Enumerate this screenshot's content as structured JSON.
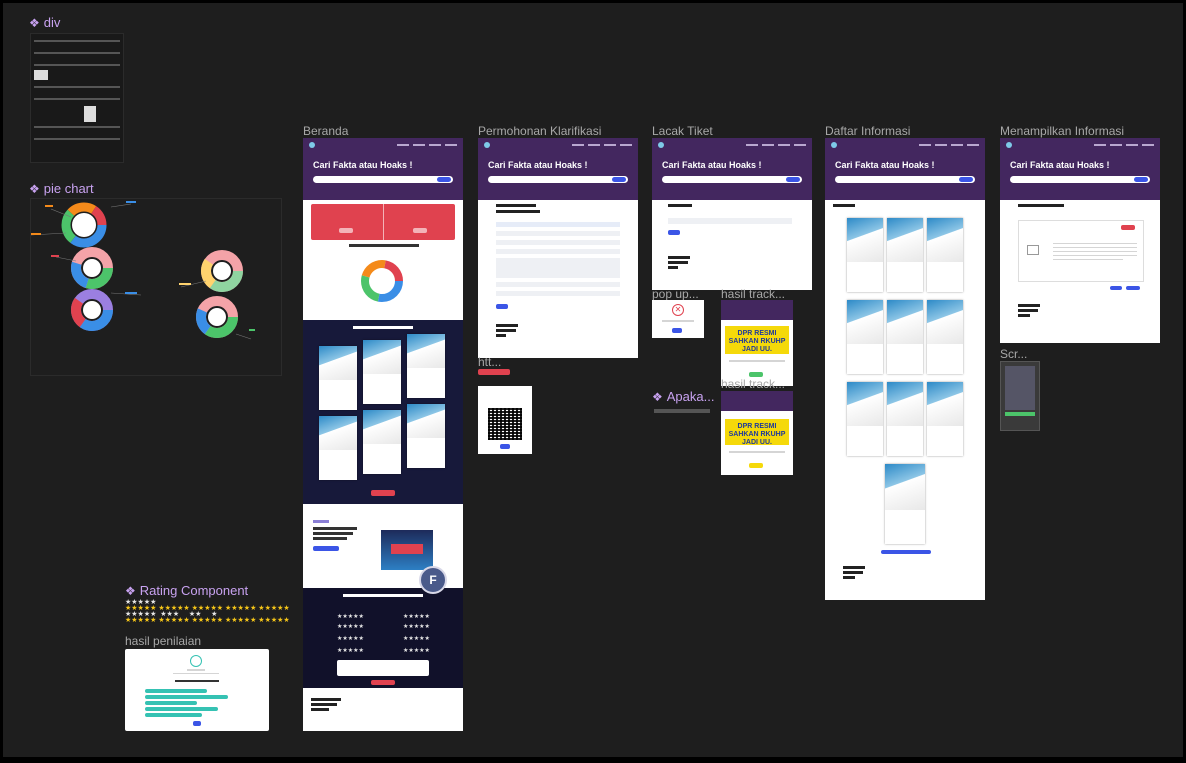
{
  "components": {
    "div": "div",
    "pie_chart": "pie chart",
    "rating": "Rating Component",
    "apaka": "Apaka..."
  },
  "frames": {
    "beranda": "Beranda",
    "permohonan": "Permohonan Klarifikasi",
    "lacak": "Lacak Tiket",
    "daftar": "Daftar Informasi",
    "menampilkan": "Menampilkan Informasi",
    "hasil_penilaian": "hasil penilaian",
    "popup": "pop up...",
    "hasil_track_1": "hasil track...",
    "hasil_track_2": "hasil track...",
    "scr": "Scr...",
    "htt": "htt..."
  },
  "site": {
    "hero_title": "Cari Fakta atau Hoaks !",
    "hoax_headline": "DPR RESMI SAHKAN RKUHP JADI UU."
  },
  "avatar": {
    "initial": "F",
    "color": "#4a5a8a"
  },
  "colors": {
    "accent_purple": "#43275f",
    "button_blue": "#3b55e6",
    "alert_red": "#e0424f",
    "canvas": "#1e1e1e"
  }
}
